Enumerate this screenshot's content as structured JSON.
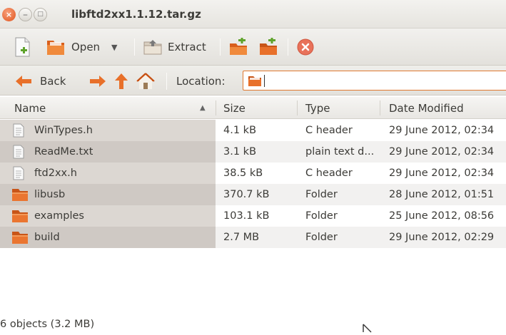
{
  "window": {
    "title": "libftd2xx1.1.12.tar.gz"
  },
  "toolbar": {
    "open_label": "Open",
    "extract_label": "Extract",
    "icons": [
      "new-archive-icon",
      "open-folder-icon",
      "extract-icon",
      "add-files-icon",
      "add-folder-icon",
      "stop-icon"
    ]
  },
  "location": {
    "back_label": "Back",
    "label": "Location:",
    "value": ""
  },
  "columns": [
    "Name",
    "Size",
    "Type",
    "Date Modified"
  ],
  "files": [
    {
      "name": "WinTypes.h",
      "size": "4.1 kB",
      "type": "C header",
      "date": "29 June 2012, 02:34",
      "icon": "text-file-icon"
    },
    {
      "name": "ReadMe.txt",
      "size": "3.1 kB",
      "type": "plain text d...",
      "date": "29 June 2012, 02:34",
      "icon": "text-file-icon"
    },
    {
      "name": "ftd2xx.h",
      "size": "38.5 kB",
      "type": "C header",
      "date": "29 June 2012, 02:34",
      "icon": "text-file-icon"
    },
    {
      "name": "libusb",
      "size": "370.7 kB",
      "type": "Folder",
      "date": "28 June 2012, 01:51",
      "icon": "folder-icon"
    },
    {
      "name": "examples",
      "size": "103.1 kB",
      "type": "Folder",
      "date": "25 June 2012, 08:56",
      "icon": "folder-icon"
    },
    {
      "name": "build",
      "size": "2.7 MB",
      "type": "Folder",
      "date": "29 June 2012, 02:29",
      "icon": "folder-icon"
    }
  ],
  "status": {
    "text": "6 objects (3.2 MB)"
  },
  "colors": {
    "accent": "#e0782f",
    "folder": "#e8702a",
    "close": "#e0531c"
  }
}
